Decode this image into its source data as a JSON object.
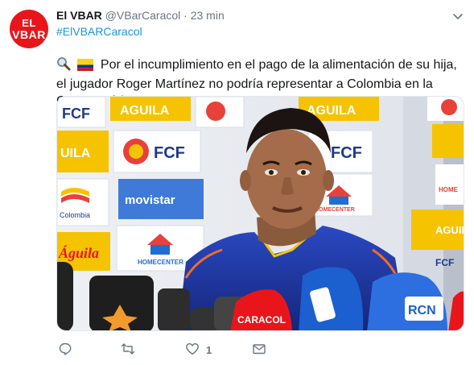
{
  "account": {
    "avatar_text_line1": "EL",
    "avatar_text_line2": "VBAR",
    "name": "El VBAR",
    "handle": "@VBarCaracol",
    "separator": "·",
    "time": "23 min",
    "hashtag": "#ElVBARCaracol"
  },
  "tweet": {
    "emojis": [
      "magnifying-glass-icon",
      "colombia-flag-icon"
    ],
    "text": "Por el incumplimiento en el pago de la alimentación de su hija, el jugador Roger Martínez no podría representar a Colombia en la Copa América."
  },
  "media": {
    "backdrop_words": [
      "FCF",
      "AGUILA",
      "AGUILA",
      "FCF",
      "movistar",
      "FCF",
      "HOMECENTER",
      "HOMECENTER",
      "AGUILA",
      "Águila",
      "Colombia",
      "HOME"
    ],
    "mic_labels": [
      "CARACOL",
      "RCN"
    ]
  },
  "actions": {
    "reply_icon": "reply-icon",
    "retweet_icon": "retweet-icon",
    "like_icon": "heart-icon",
    "like_count": "1",
    "message_icon": "envelope-icon"
  },
  "colors": {
    "brand_red": "#e8161b",
    "link_blue": "#1b95e0",
    "muted_gray": "#657786",
    "jersey_blue": "#1e3aa6"
  }
}
